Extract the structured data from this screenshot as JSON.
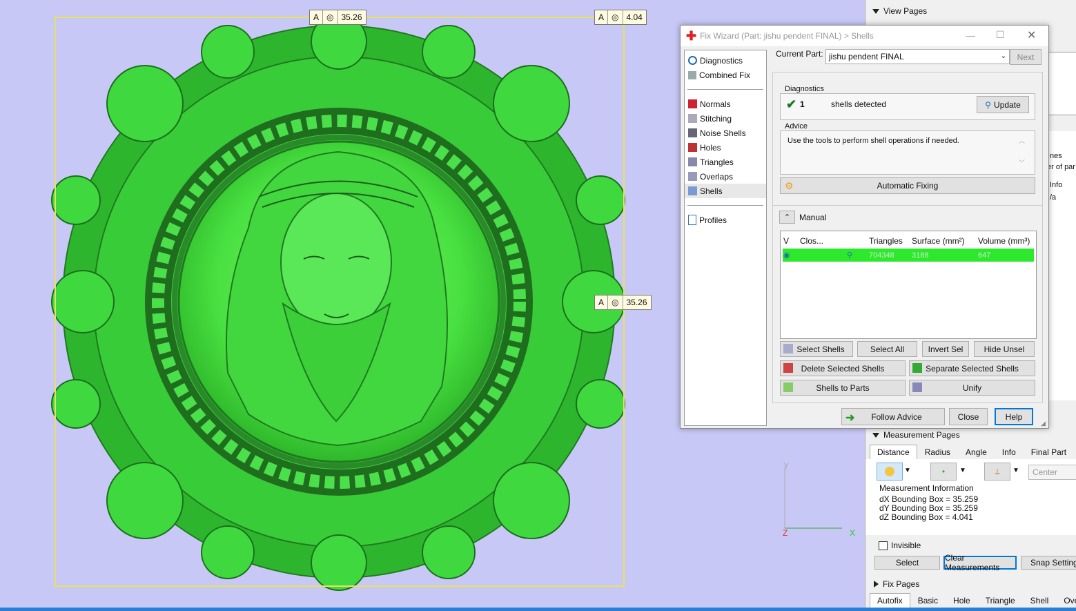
{
  "viewport": {
    "dim_top_left": {
      "a": "A",
      "sym": "◎",
      "val": "35.26"
    },
    "dim_top_right": {
      "a": "A",
      "sym": "◎",
      "val": "4.04"
    },
    "dim_right": {
      "a": "A",
      "sym": "◎",
      "val": "35.26"
    },
    "axes": {
      "y": "Y",
      "z": "Z",
      "x": "X"
    }
  },
  "right_panel": {
    "view_pages": "View Pages",
    "partial_labels": [
      "nes",
      "er of par",
      "Info",
      "/a"
    ],
    "measurement_pages": "Measurement Pages",
    "measure_tabs": [
      "Distance",
      "Radius",
      "Angle",
      "Info",
      "Final Part"
    ],
    "center_placeholder": "Center",
    "measurement_info_title": "Measurement Information",
    "measurement_lines": [
      "dX Bounding Box = 35.259",
      "dY Bounding Box = 35.259",
      "dZ Bounding Box = 4.041"
    ],
    "invisible_label": "Invisible",
    "select_btn": "Select",
    "clear_btn": "Clear Measurements",
    "snap_btn": "Snap Settings",
    "fix_pages": "Fix Pages",
    "fix_tabs": [
      "Autofix",
      "Basic",
      "Hole",
      "Triangle",
      "Shell",
      "Over"
    ]
  },
  "dialog": {
    "title": "Fix Wizard (Part: jishu pendent  FINAL) > Shells",
    "nav": {
      "group1": [
        "Diagnostics",
        "Combined Fix"
      ],
      "group2": [
        "Normals",
        "Stitching",
        "Noise Shells",
        "Holes",
        "Triangles",
        "Overlaps",
        "Shells"
      ],
      "group3": [
        "Profiles"
      ],
      "selected": "Shells"
    },
    "current_part_label": "Current Part:",
    "current_part_value": "jishu pendent  FINAL",
    "next_btn": "Next",
    "diagnostics_title": "Diagnostics",
    "shell_count": "1",
    "shells_detected": "shells detected",
    "update_btn": "Update",
    "advice_title": "Advice",
    "advice_text": "Use the tools to perform shell operations if needed.",
    "auto_fix_btn": "Automatic Fixing",
    "manual_title": "Manual",
    "table_headers": [
      "V",
      "Clos...",
      "",
      "Triangles",
      "Surface (mm²)",
      "Volume (mm³)"
    ],
    "row": {
      "triangles": "704348",
      "surface": "3188",
      "volume": "647"
    },
    "buttons": {
      "select_shells": "Select Shells",
      "select_all": "Select All",
      "invert_sel": "Invert Sel",
      "hide_unsel": "Hide Unsel",
      "delete_selected": "Delete Selected Shells",
      "separate_selected": "Separate Selected Shells",
      "shells_to_parts": "Shells to Parts",
      "unify": "Unify",
      "follow_advice": "Follow Advice",
      "close": "Close",
      "help": "Help"
    }
  },
  "colors": {
    "model_green": "#3fd93f",
    "viewport_bg": "#c8c8f6",
    "row_green": "#2ee82e",
    "accent_blue": "#0078d7"
  }
}
